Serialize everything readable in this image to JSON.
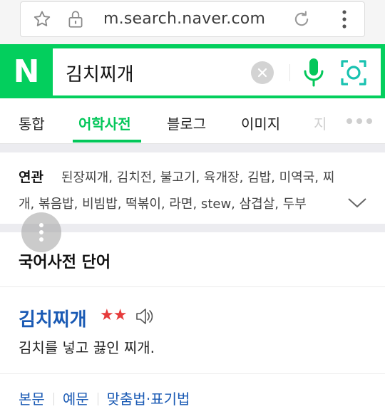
{
  "browser": {
    "url": "m.search.naver.com"
  },
  "search": {
    "logo": "N",
    "query": "김치찌개"
  },
  "tabs": [
    {
      "label": "통합"
    },
    {
      "label": "어학사전"
    },
    {
      "label": "블로그"
    },
    {
      "label": "이미지"
    },
    {
      "label": "지"
    }
  ],
  "related": {
    "title": "연관",
    "line1": "된장찌개, 김치전, 불고기, 육개장, 김밥, 미역국, 찌",
    "line2": "개, 볶음밥, 비빔밥, 떡볶이, 라면, stew, 삼겹살, 두부"
  },
  "dictionary": {
    "section_title": "국어사전 단어",
    "word": "김치찌개",
    "stars": "★★",
    "definition": "김치를 넣고 끓인 찌개.",
    "links": [
      "본문",
      "예문",
      "맞춤법·표기법"
    ]
  },
  "colors": {
    "brand_green": "#03cf5d",
    "tab_active": "#03c75a",
    "link_blue": "#1a5ab4",
    "star_red": "#e63b3b"
  },
  "icons": {
    "star": "star-icon",
    "lock": "lock-icon",
    "reload": "reload-icon",
    "overflow": "overflow-menu-icon",
    "clear": "clear-icon",
    "mic": "microphone-icon",
    "lens": "camera-lens-icon",
    "more": "more-dots-icon",
    "chevron": "chevron-down-icon",
    "speaker": "speaker-icon"
  }
}
